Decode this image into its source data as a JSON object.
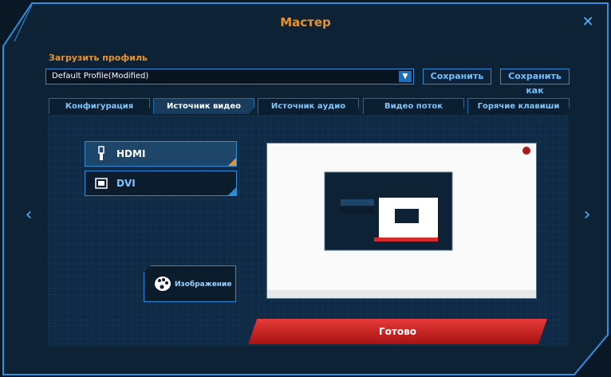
{
  "window": {
    "title": "Мастер"
  },
  "profile": {
    "label": "Загрузить профиль",
    "value": "Default Profile(Modified)",
    "save": "Сохранить",
    "save_as": "Сохранить как"
  },
  "tabs": [
    {
      "label": "Конфигурация"
    },
    {
      "label": "Источник видео"
    },
    {
      "label": "Источник аудио"
    },
    {
      "label": "Видео поток"
    },
    {
      "label": "Горячие клавиши"
    }
  ],
  "sources": [
    {
      "label": "HDMI",
      "selected": true
    },
    {
      "label": "DVI",
      "selected": false
    }
  ],
  "image_button": {
    "label": "Изображение"
  },
  "done": {
    "label": "Готово"
  },
  "colors": {
    "accent": "#e8922b",
    "blue": "#2e8bd6",
    "red": "#d42b2b"
  }
}
